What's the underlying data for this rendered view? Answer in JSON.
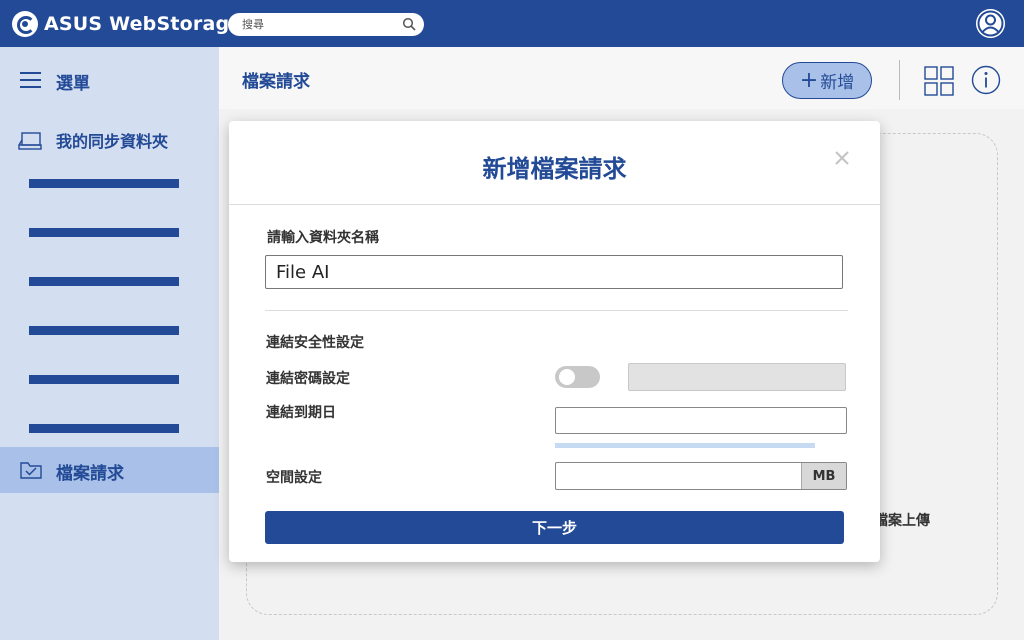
{
  "topbar": {
    "app_name": "ASUS WebStorage",
    "search_placeholder": "搜尋"
  },
  "sidebar": {
    "menu_label": "選單",
    "sync_folder_label": "我的同步資料夾",
    "file_request_label": "檔案請求"
  },
  "main": {
    "page_title": "檔案請求",
    "add_button_label": "新增",
    "dropzone_text": "檔案上傳"
  },
  "modal": {
    "title": "新增檔案請求",
    "folder_name_label": "請輸入資料夾名稱",
    "folder_name_value": "File AI",
    "security_heading": "連結安全性設定",
    "password_label": "連結密碼設定",
    "expiry_label": "連結到期日",
    "space_label": "空間設定",
    "space_unit": "MB",
    "next_button_label": "下一步"
  },
  "colors": {
    "brand": "#234a96",
    "sidebar_bg": "#d3def0",
    "sidebar_active": "#a9c1e8"
  }
}
